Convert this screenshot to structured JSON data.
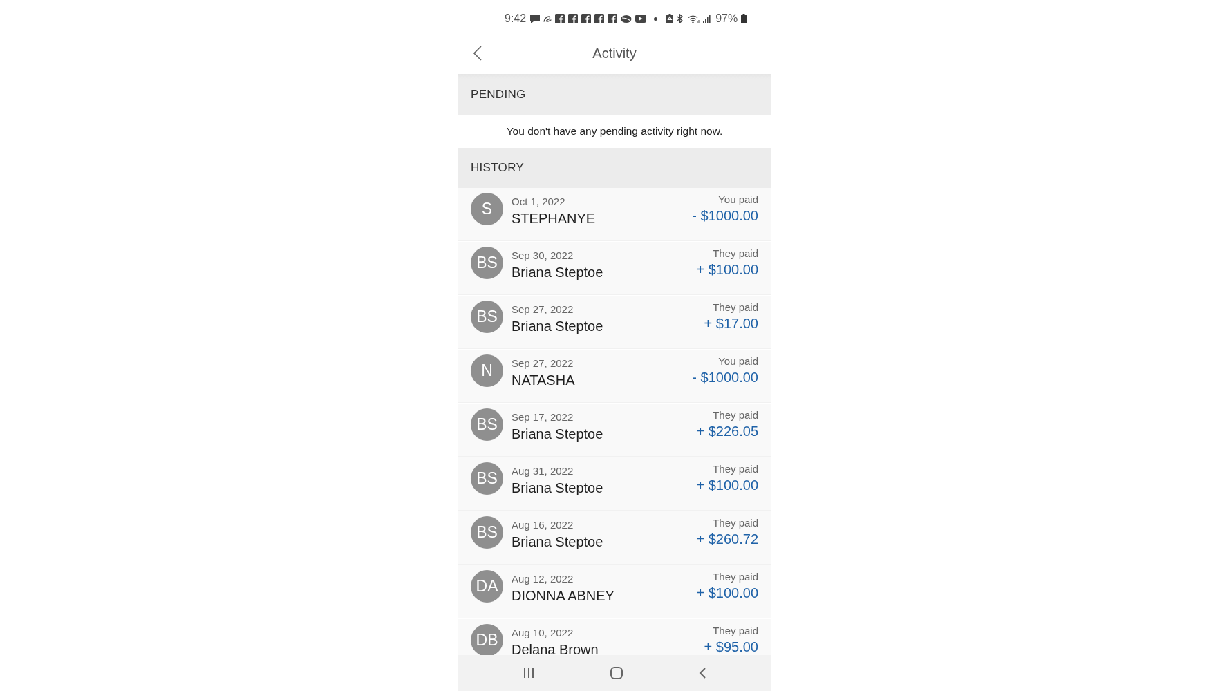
{
  "status_bar": {
    "time": "9:42",
    "battery": "97%"
  },
  "header": {
    "title": "Activity"
  },
  "pending": {
    "heading": "PENDING",
    "message": "You don't have any pending activity right now."
  },
  "history": {
    "heading": "HISTORY",
    "rows": [
      {
        "initials": "S",
        "date": "Oct 1, 2022",
        "name": "STEPHANYE",
        "direction": "You paid",
        "amount": "- $1000.00"
      },
      {
        "initials": "BS",
        "date": "Sep 30, 2022",
        "name": "Briana Steptoe",
        "direction": "They paid",
        "amount": "+ $100.00"
      },
      {
        "initials": "BS",
        "date": "Sep 27, 2022",
        "name": "Briana Steptoe",
        "direction": "They paid",
        "amount": "+ $17.00"
      },
      {
        "initials": "N",
        "date": "Sep 27, 2022",
        "name": "NATASHA",
        "direction": "You paid",
        "amount": "- $1000.00"
      },
      {
        "initials": "BS",
        "date": "Sep 17, 2022",
        "name": "Briana Steptoe",
        "direction": "They paid",
        "amount": "+ $226.05"
      },
      {
        "initials": "BS",
        "date": "Aug 31, 2022",
        "name": "Briana Steptoe",
        "direction": "They paid",
        "amount": "+ $100.00"
      },
      {
        "initials": "BS",
        "date": "Aug 16, 2022",
        "name": "Briana Steptoe",
        "direction": "They paid",
        "amount": "+ $260.72"
      },
      {
        "initials": "DA",
        "date": "Aug 12, 2022",
        "name": "DIONNA ABNEY",
        "direction": "They paid",
        "amount": "+ $100.00"
      },
      {
        "initials": "DB",
        "date": "Aug 10, 2022",
        "name": "Delana Brown",
        "direction": "They paid",
        "amount": "+ $95.00"
      }
    ]
  }
}
